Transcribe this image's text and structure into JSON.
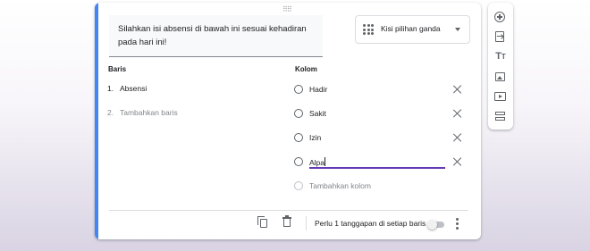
{
  "question": {
    "title": "Silahkan isi absensi di bawah ini sesuai kehadiran pada hari ini!",
    "type_label": "Kisi pilihan ganda"
  },
  "rows": {
    "header": "Baris",
    "items": [
      {
        "number": "1.",
        "label": "Absensi"
      }
    ],
    "add": {
      "number": "2.",
      "label": "Tambahkan baris"
    }
  },
  "columns": {
    "header": "Kolom",
    "items": [
      "Hadir",
      "Sakit",
      "Izin",
      "Alpa"
    ],
    "add_label": "Tambahkan kolom"
  },
  "footer": {
    "required_label": "Perlu 1 tanggapan di setiap baris",
    "required_enabled": false
  },
  "toolbar": {
    "icons": [
      "add-question-icon",
      "import-questions-icon",
      "add-title-icon",
      "add-image-icon",
      "add-video-icon",
      "add-section-icon"
    ]
  },
  "colors": {
    "accent": "#4285f4",
    "focus_underline": "#673ab7",
    "icon": "#5f6368"
  }
}
